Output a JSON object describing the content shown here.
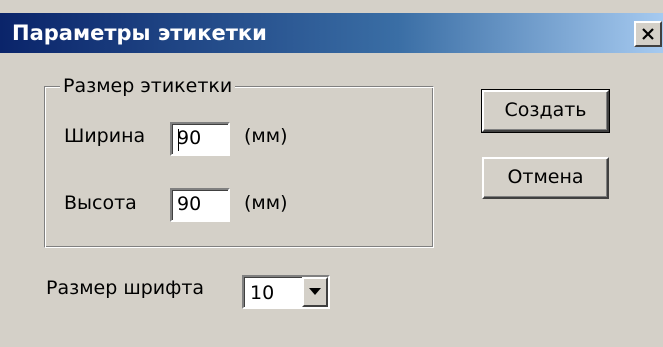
{
  "window": {
    "title": "Параметры этикетки",
    "close_icon": "close-icon"
  },
  "label_size_group": {
    "legend": "Размер этикетки",
    "width_label": "Ширина",
    "width_value": "90",
    "width_unit": "(мм)",
    "height_label": "Высота",
    "height_value": "90",
    "height_unit": "(мм)"
  },
  "buttons": {
    "create_label": "Создать",
    "cancel_label": "Отмена"
  },
  "font_size": {
    "label": "Размер шрифта",
    "selected_value": "10",
    "dropdown_icon": "chevron-down-icon"
  },
  "colors": {
    "title_gradient_start": "#0a246a",
    "title_gradient_end": "#a6caf0",
    "dialog_background": "#d4d0c8"
  }
}
